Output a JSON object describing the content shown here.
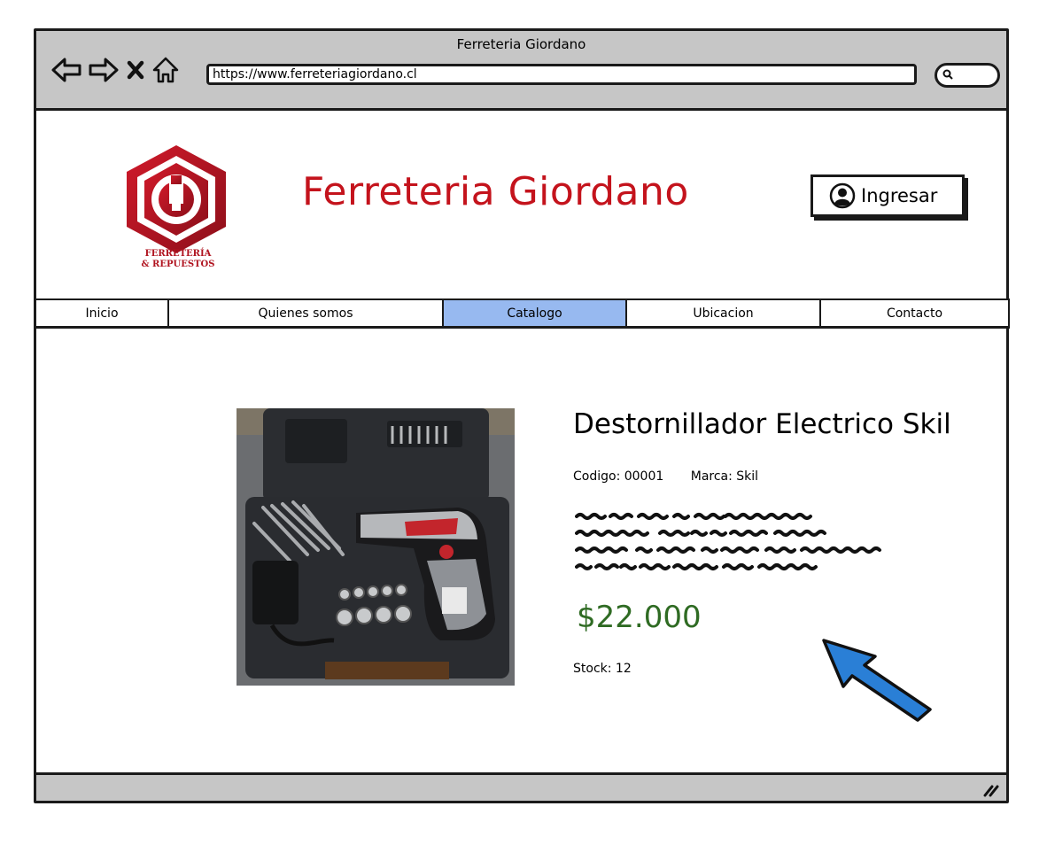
{
  "window": {
    "title": "Ferreteria Giordano"
  },
  "browser": {
    "url": "https://www.ferreteriagiordano.cl",
    "icons": [
      "back-arrow-icon",
      "forward-arrow-icon",
      "close-icon",
      "home-icon",
      "search-icon"
    ]
  },
  "header": {
    "logo_line1": "FERRETERÍA",
    "logo_line2": "& REPUESTOS",
    "site_title": "Ferreteria Giordano",
    "login_label": "Ingresar"
  },
  "menu": {
    "items": [
      {
        "label": "Inicio"
      },
      {
        "label": "Quienes somos"
      },
      {
        "label": "Catalogo",
        "active": true
      },
      {
        "label": "Ubicacion"
      },
      {
        "label": "Contacto"
      }
    ]
  },
  "product": {
    "title": "Destornillador Electrico Skil",
    "code_label": "Codigo: 00001",
    "brand_label": "Marca: Skil",
    "price": "$22.000",
    "stock_label": "Stock: 12"
  },
  "colors": {
    "brand_red": "#c4131c",
    "price_green": "#2f6b23",
    "active_tab": "#97b9f0",
    "chrome_gray": "#c6c6c6",
    "cursor_blue": "#2a7fd6"
  }
}
